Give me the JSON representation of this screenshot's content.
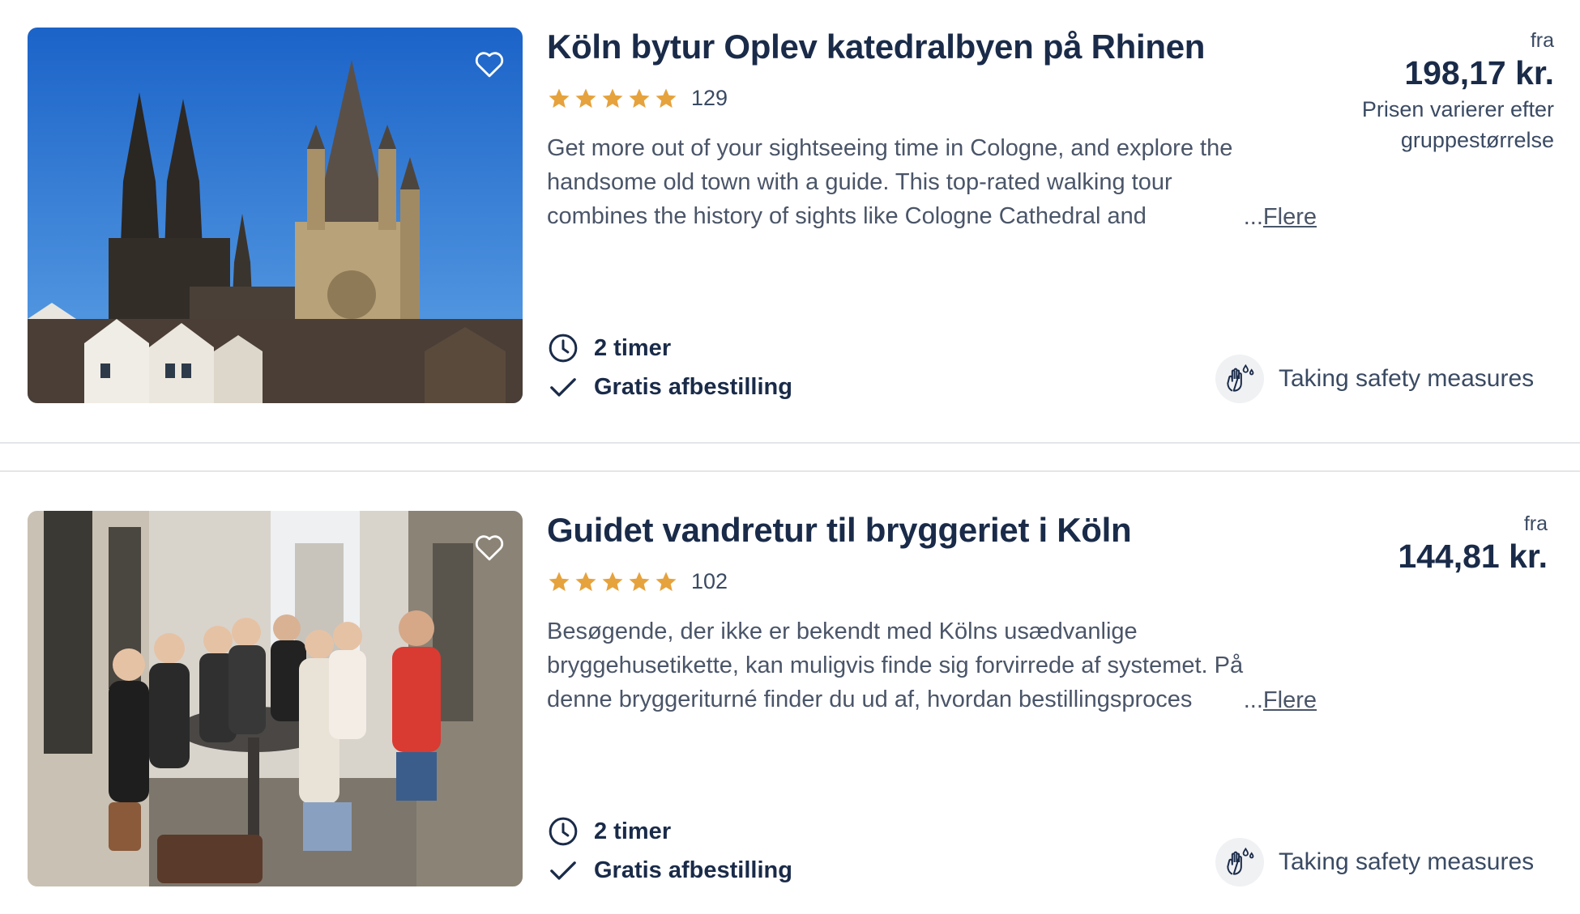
{
  "colors": {
    "star": "#e6a23c",
    "title": "#1a2b49",
    "text": "#4a5568"
  },
  "activities": [
    {
      "title": "Köln bytur Oplev katedralbyen på Rhinen",
      "rating": 5,
      "review_count": "129",
      "description": "Get more out of your sightseeing time in Cologne, and explore the handsome old town with a guide. This top-rated walking tour combines the history of sights like Cologne Cathedral and",
      "more_label": "Flere",
      "more_prefix": "...",
      "duration": "2 timer",
      "cancellation": "Gratis afbestilling",
      "safety": "Taking safety measures",
      "price_from": "fra",
      "price": "198,17 kr.",
      "price_note": "Prisen varierer efter gruppestørrelse",
      "image_icon": "cologne-cathedral-photo"
    },
    {
      "title": "Guidet vandretur til bryggeriet i Köln",
      "rating": 5,
      "review_count": "102",
      "description": "Besøgende, der ikke er bekendt med Kölns usædvanlige bryggehusetikette, kan muligvis finde sig forvirrede af systemet. På denne bryggeriturné finder du ud af, hvordan bestillingsproces",
      "more_label": "Flere",
      "more_prefix": "...",
      "duration": "2 timer",
      "cancellation": "Gratis afbestilling",
      "safety": "Taking safety measures",
      "price_from": "fra",
      "price": "144,81 kr.",
      "image_icon": "brewery-group-photo"
    }
  ]
}
